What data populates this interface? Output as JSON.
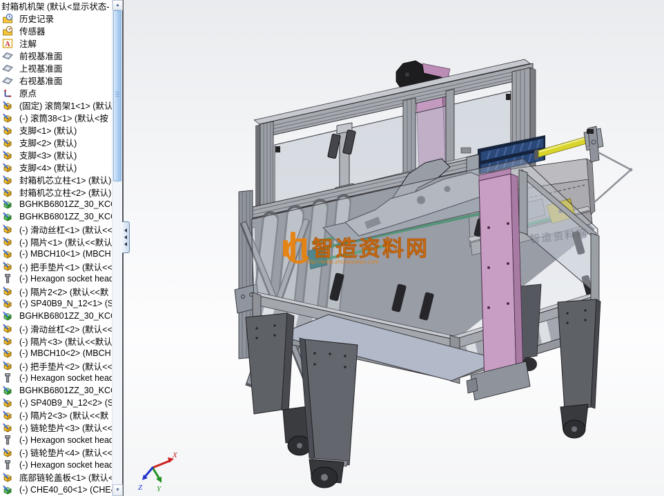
{
  "feature_tree": {
    "root_label": "封箱机机架  (默认<显示状态-",
    "items": [
      {
        "label": "历史记录",
        "icon": "history"
      },
      {
        "label": "传感器",
        "icon": "sensors"
      },
      {
        "label": "注解",
        "icon": "annotations"
      },
      {
        "label": "前视基准面",
        "icon": "plane"
      },
      {
        "label": "上视基准面",
        "icon": "plane"
      },
      {
        "label": "右视基准面",
        "icon": "plane"
      },
      {
        "label": "原点",
        "icon": "origin"
      },
      {
        "label": "(固定) 滚筒架1<1> (默认<",
        "icon": "part"
      },
      {
        "label": "(-) 滚筒38<1> (默认<按",
        "icon": "part"
      },
      {
        "label": "支脚<1> (默认)",
        "icon": "part"
      },
      {
        "label": "支脚<2> (默认)",
        "icon": "part"
      },
      {
        "label": "支脚<3> (默认)",
        "icon": "part"
      },
      {
        "label": "支脚<4> (默认)",
        "icon": "part"
      },
      {
        "label": "封箱机芯立柱<1> (默认)",
        "icon": "part"
      },
      {
        "label": "封箱机芯立柱<2> (默认)",
        "icon": "part"
      },
      {
        "label": "BGHKB6801ZZ_30_KCC<",
        "icon": "part-green"
      },
      {
        "label": "BGHKB6801ZZ_30_KCC<",
        "icon": "part-green"
      },
      {
        "label": "(-) 滑动丝杠<1> (默认<<",
        "icon": "part"
      },
      {
        "label": "(-) 隔片<1> (默认<<默认",
        "icon": "part"
      },
      {
        "label": "(-) MBCH10<1> (MBCH",
        "icon": "part"
      },
      {
        "label": "(-) 把手垫片<1> (默认<<",
        "icon": "part"
      },
      {
        "label": "(-) Hexagon socket head",
        "icon": "bolt"
      },
      {
        "label": "(-) 隔片2<2> (默认<<默",
        "icon": "part"
      },
      {
        "label": "(-) SP40B9_N_12<1> (SP",
        "icon": "part"
      },
      {
        "label": "BGHKB6801ZZ_30_KCC<",
        "icon": "part-green"
      },
      {
        "label": "(-) 滑动丝杠<2> (默认<<",
        "icon": "part"
      },
      {
        "label": "(-) 隔片<3> (默认<<默认",
        "icon": "part"
      },
      {
        "label": "(-) MBCH10<2> (MBCH",
        "icon": "part"
      },
      {
        "label": "(-) 把手垫片<2> (默认<<",
        "icon": "part"
      },
      {
        "label": "(-) Hexagon socket head",
        "icon": "bolt"
      },
      {
        "label": "BGHKB6801ZZ_30_KCC<",
        "icon": "part-green"
      },
      {
        "label": "(-) SP40B9_N_12<2> (SP",
        "icon": "part"
      },
      {
        "label": "(-) 隔片2<3> (默认<<默",
        "icon": "part"
      },
      {
        "label": "(-) 链轮垫片<3> (默认<<",
        "icon": "part"
      },
      {
        "label": "(-) Hexagon socket head",
        "icon": "bolt"
      },
      {
        "label": "(-) 链轮垫片<4> (默认<<",
        "icon": "part"
      },
      {
        "label": "(-) Hexagon socket head",
        "icon": "bolt"
      },
      {
        "label": "底部链轮盖板<1> (默认<",
        "icon": "part"
      },
      {
        "label": "(-) CHE40_60<1> (CHE4",
        "icon": "part-green"
      }
    ]
  },
  "viewport": {
    "watermark_center": {
      "logo": "zhizao-logo",
      "title": "智造资料网",
      "url": "http://www.zhizaoziliao.com"
    },
    "watermark_side": "智造资料网",
    "triad": {
      "x": "X",
      "y": "Y",
      "z": "Z"
    }
  },
  "colors": {
    "accent_orange": "#e8820e",
    "pink_column": "#c89ec4",
    "blue_roller": "#2a4878",
    "yellow_rod": "#d8d42c",
    "frame_gray": "#a6a9af",
    "leg_gray": "#5e6166",
    "scrollbar_thumb": "#abccf0"
  }
}
